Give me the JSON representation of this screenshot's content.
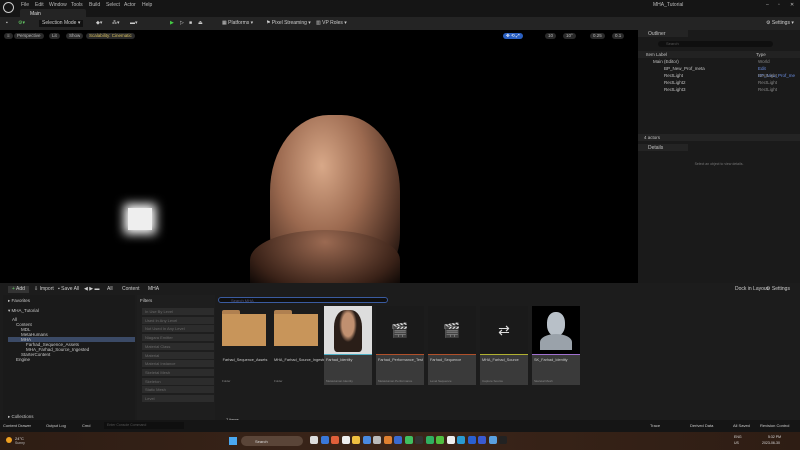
{
  "app": {
    "window_title": "MHA_Tutorial",
    "tab": "Main"
  },
  "menu": [
    "File",
    "Edit",
    "Window",
    "Tools",
    "Build",
    "Select",
    "Actor",
    "Help"
  ],
  "toolbar": {
    "selection_mode": "Selection Mode",
    "platforms": "Platforms",
    "pixel_streaming": "Pixel Streaming",
    "vp_roles": "VP Roles",
    "settings": "Settings"
  },
  "viewport": {
    "perspective": "Perspective",
    "lit": "Lit",
    "show": "Show",
    "scalability": "Scalability: Cinematic",
    "grid": "10",
    "angle": "10°",
    "scale": "0.25",
    "camera_speed": "0.1"
  },
  "outliner": {
    "title": "Outliner",
    "search_placeholder": "Search",
    "col_label": "Item Label",
    "col_type": "Type",
    "rows": [
      {
        "label": "Main (Editor)",
        "type": "World"
      },
      {
        "label": "BP_New_Prof_meta",
        "type": "Edit BP_New_Prof_me"
      },
      {
        "label": "RectLight",
        "type": "RectLight"
      },
      {
        "label": "RectLight2",
        "type": "RectLight"
      },
      {
        "label": "RectLight3",
        "type": "RectLight"
      }
    ],
    "count": "4 actors"
  },
  "details": {
    "title": "Details",
    "empty": "Select an object to view details."
  },
  "content_browser": {
    "add": "Add",
    "import": "Import",
    "save_all": "Save All",
    "breadcrumb": [
      "All",
      "Content",
      "MHA"
    ],
    "dock": "Dock in Layout",
    "settings": "Settings",
    "favorites": "Favorites",
    "project": "MHA_Tutorial",
    "tree": [
      "All",
      "Content",
      "MDL",
      "MetaHumans",
      "MHA",
      "Farhad_Sequence_Assets",
      "MHA_Farhad_Source_Ingested",
      "StarterContent",
      "Engine"
    ],
    "filters_title": "Filters",
    "filters": [
      "In Use By Level",
      "Used In Any Level",
      "Not Used In Any Level",
      "Niagara Emitter",
      "Material Class",
      "Material",
      "Material Instance",
      "Skeletal Mesh",
      "Skeleton",
      "Static Mesh",
      "Level"
    ],
    "search_placeholder": "Search MHA",
    "assets": [
      {
        "name": "Farhad_Sequence_Assets",
        "type": "Folder",
        "color": ""
      },
      {
        "name": "MHA_Farhad_Source_Ingested",
        "type": "Folder",
        "color": ""
      },
      {
        "name": "Farhad_Identity",
        "type": "MetaHuman Identity",
        "color": "#4fb0c6"
      },
      {
        "name": "Farhad_Performance_Test",
        "type": "MetaHuman Performance",
        "color": "#b0502a"
      },
      {
        "name": "Farhad_Sequence",
        "type": "Level Sequence",
        "color": "#b0502a"
      },
      {
        "name": "MHA_Farhad_Source",
        "type": "Capture Source",
        "color": "#b0b030"
      },
      {
        "name": "SK_Farhad_Identity",
        "type": "Skeletal Mesh",
        "color": "#a070d0"
      }
    ],
    "item_count": "7 items",
    "collections": "Collections"
  },
  "statusbar": {
    "content_drawer": "Content Drawer",
    "output_log": "Output Log",
    "cmd": "Cmd",
    "console_placeholder": "Enter Console Command",
    "trace": "Trace",
    "derived_data": "Derived Data",
    "all_saved": "All Saved",
    "revision_control": "Revision Control"
  },
  "taskbar": {
    "weather_temp": "24°C",
    "weather_text": "Sunny",
    "search": "Search",
    "lang": "ENG",
    "region": "US",
    "time": "5:32 PM",
    "date": "2023-06-30"
  }
}
